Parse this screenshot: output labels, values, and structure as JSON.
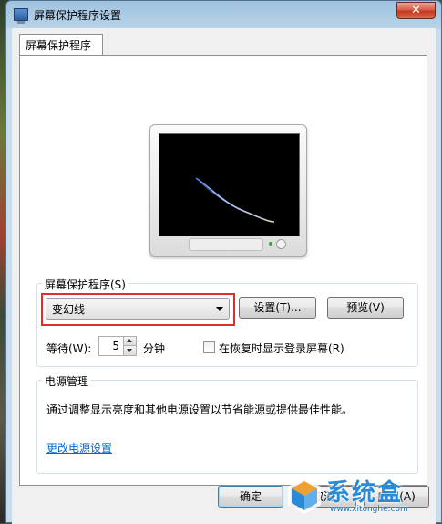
{
  "window": {
    "title": "屏幕保护程序设置",
    "close_label": "✕"
  },
  "tab": {
    "label": "屏幕保护程序"
  },
  "screensaver_group": {
    "label": "屏幕保护程序(S)",
    "selected": "变幻线",
    "settings_button": "设置(T)...",
    "preview_button": "预览(V)",
    "wait_label": "等待(W):",
    "wait_value": "5",
    "wait_unit": "分钟",
    "resume_checkbox_label": "在恢复时显示登录屏幕(R)",
    "resume_checked": false
  },
  "power_group": {
    "label": "电源管理",
    "description": "通过调整显示亮度和其他电源设置以节省能源或提供最佳性能。",
    "link": "更改电源设置"
  },
  "footer": {
    "ok_button": "确定",
    "cancel_button": "取消",
    "apply_button": "应用(A)"
  },
  "watermark": {
    "text": "系统盒",
    "url": "www.xitonghe.com"
  },
  "colors": {
    "highlight": "#d9302a",
    "link": "#0066cc",
    "screen": "#000000"
  }
}
